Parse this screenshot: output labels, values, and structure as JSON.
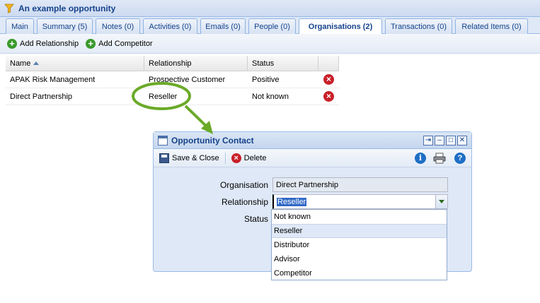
{
  "window": {
    "title": "An example opportunity"
  },
  "tabs": [
    {
      "label": "Main"
    },
    {
      "label": "Summary (5)"
    },
    {
      "label": "Notes (0)"
    },
    {
      "label": "Activities (0)"
    },
    {
      "label": "Emails (0)"
    },
    {
      "label": "People (0)"
    },
    {
      "label": "Organisations (2)",
      "active": true
    },
    {
      "label": "Transactions (0)"
    },
    {
      "label": "Related Items (0)"
    }
  ],
  "toolbar": {
    "add_relationship": "Add Relationship",
    "add_competitor": "Add Competitor"
  },
  "grid": {
    "columns": [
      "Name",
      "Relationship",
      "Status"
    ],
    "rows": [
      {
        "name": "APAK Risk Management",
        "relationship": "Prospective Customer",
        "status": "Positive"
      },
      {
        "name": "Direct Partnership",
        "relationship": "Reseller",
        "status": "Not known"
      }
    ]
  },
  "dialog": {
    "title": "Opportunity Contact",
    "save_close": "Save & Close",
    "delete": "Delete",
    "fields": {
      "organisation_label": "Organisation",
      "organisation_value": "Direct Partnership",
      "relationship_label": "Relationship",
      "relationship_value": "Reseller",
      "status_label": "Status"
    },
    "relationship_options": [
      "Not known",
      "Reseller",
      "Distributor",
      "Advisor",
      "Competitor"
    ]
  },
  "colors": {
    "accent": "#15428b",
    "highlight": "#3169c6",
    "annotation": "#6aaa28"
  }
}
